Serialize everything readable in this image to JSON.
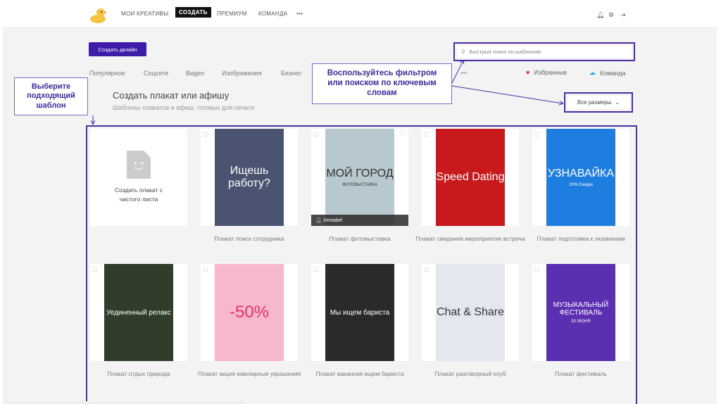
{
  "nav": {
    "items": [
      "МОИ КРЕАТИВЫ",
      "СОЗДАТЬ",
      "ПРЕМИУМ",
      "КОМАНДА"
    ],
    "more": "•••",
    "active": "СОЗДАТЬ"
  },
  "create_button": "Создать дизайн",
  "categories": [
    "Популярное",
    "Соцсети",
    "Видео",
    "Изображения",
    "Бизнес"
  ],
  "search": {
    "placeholder": "Быстрый поиск по шаблонам"
  },
  "favorites": "Избранные",
  "team": "Команда",
  "section": {
    "title": "Создать плакат или афишу",
    "subtitle": "Шаблоны плакатов и афиш, готовых для печати"
  },
  "size_filter": "Все размеры",
  "callouts": {
    "left": "Выберите подходящий шаблон",
    "middle": "Воспользуйтесь фильтром или поиском по ключевым словам"
  },
  "blank_card": "Создать плакат с чистого листа",
  "templates": [
    {
      "label": "Плакат поиск сотрудника",
      "poster": "Ищешь работу?",
      "color": "#4a5470"
    },
    {
      "label": "Плакат фотовыставка",
      "poster": "МОЙ ГОРОД",
      "sub": "ФОТОВЫСТАВКА",
      "author": "Xeniabel",
      "color": "#b8c8cf"
    },
    {
      "label": "Плакат свидания мероприятие встреча",
      "poster": "Speed Dating",
      "color": "#c8191c"
    },
    {
      "label": "Плакат подготовка к экзаменам",
      "poster": "УЗНАВАЙКА",
      "sub": "20% Скидка",
      "color": "#1e7ee0"
    },
    {
      "label": "Плакат отдых природа",
      "poster": "Уединенный релакс",
      "color": "#2f3d2a"
    },
    {
      "label": "Плакат акция ювелирные украшения",
      "poster": "-50%",
      "color": "#f7b8cb"
    },
    {
      "label": "Плакат вакансия ищем бариста",
      "poster": "Мы ищем бариста",
      "color": "#2a2a2a"
    },
    {
      "label": "Плакат разговорный клуб",
      "poster": "Chat & Share",
      "color": "#e4e7ee"
    },
    {
      "label": "Плакат фестиваль",
      "poster": "МУЗЫКАЛЬНЫЙ ФЕСТИВАЛЬ",
      "sub": "30 ИЮНЯ",
      "color": "#5a2fb0"
    }
  ]
}
